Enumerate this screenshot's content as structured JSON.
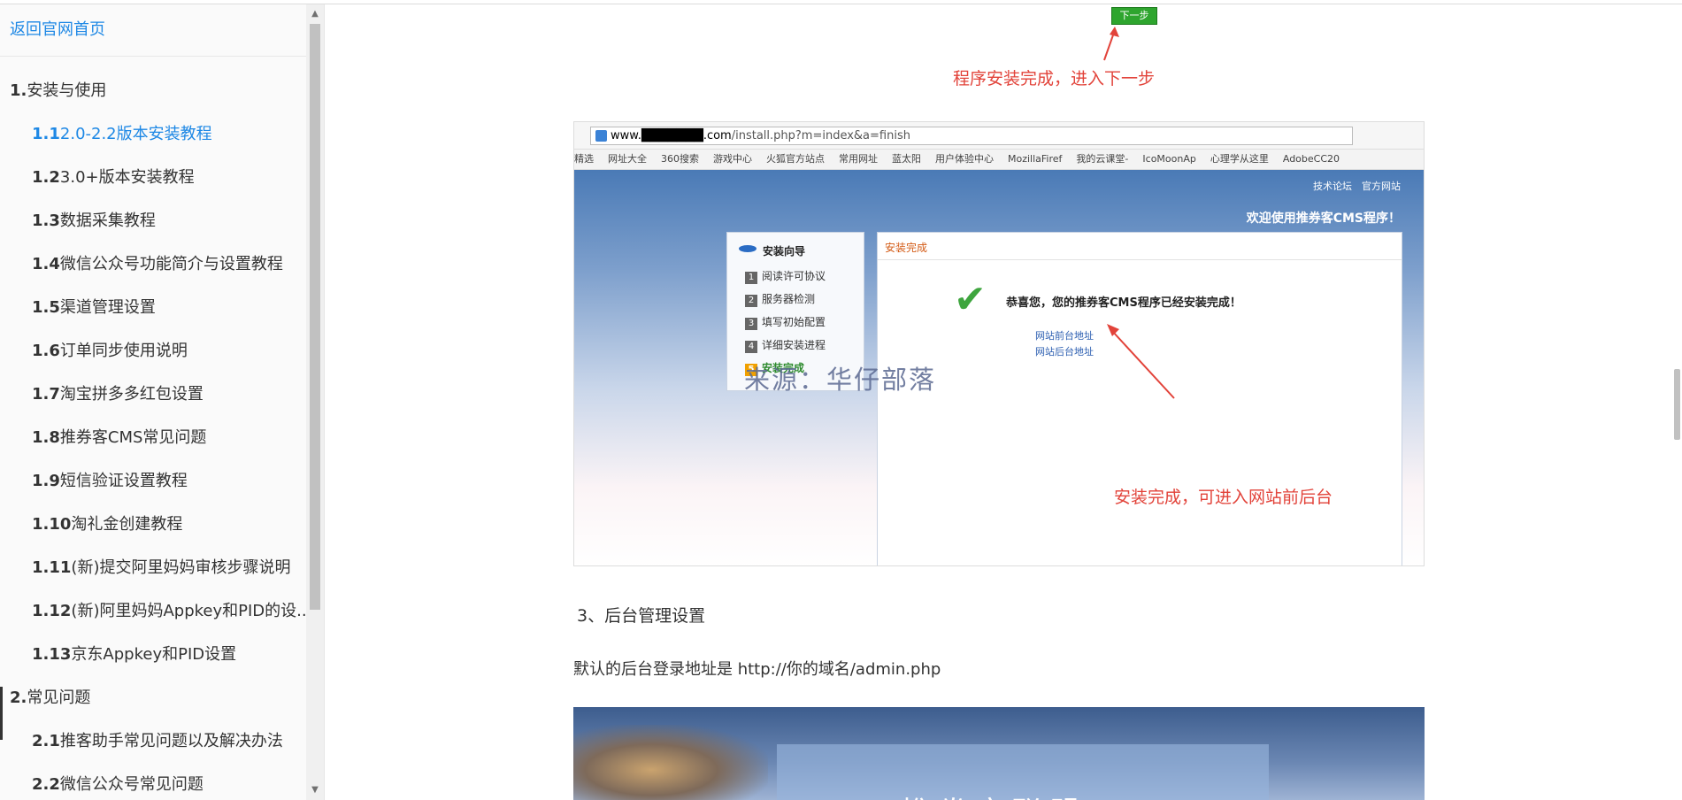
{
  "sidebar": {
    "home_link": "返回官网首页",
    "items": [
      {
        "num": "1.",
        "label": "安装与使用",
        "level": 1,
        "active": false
      },
      {
        "num": "1.1",
        "label": "2.0-2.2版本安装教程",
        "level": 2,
        "active": true
      },
      {
        "num": "1.2",
        "label": "3.0+版本安装教程",
        "level": 2,
        "active": false
      },
      {
        "num": "1.3",
        "label": "数据采集教程",
        "level": 2,
        "active": false
      },
      {
        "num": "1.4",
        "label": "微信公众号功能简介与设置教程",
        "level": 2,
        "active": false
      },
      {
        "num": "1.5",
        "label": "渠道管理设置",
        "level": 2,
        "active": false
      },
      {
        "num": "1.6",
        "label": "订单同步使用说明",
        "level": 2,
        "active": false
      },
      {
        "num": "1.7",
        "label": "淘宝拼多多红包设置",
        "level": 2,
        "active": false
      },
      {
        "num": "1.8",
        "label": "推券客CMS常见问题",
        "level": 2,
        "active": false
      },
      {
        "num": "1.9",
        "label": "短信验证设置教程",
        "level": 2,
        "active": false
      },
      {
        "num": "1.10",
        "label": "淘礼金创建教程",
        "level": 2,
        "active": false
      },
      {
        "num": "1.11",
        "label": "(新)提交阿里妈妈审核步骤说明",
        "level": 2,
        "active": false
      },
      {
        "num": "1.12",
        "label": "(新)阿里妈妈Appkey和PID的设...",
        "level": 2,
        "active": false
      },
      {
        "num": "1.13",
        "label": "京东Appkey和PID设置",
        "level": 2,
        "active": false
      },
      {
        "num": "2.",
        "label": "常见问题",
        "level": 1,
        "active": false
      },
      {
        "num": "2.1",
        "label": "推客助手常见问题以及解决办法",
        "level": 2,
        "active": false
      },
      {
        "num": "2.2",
        "label": "微信公众号常见问题",
        "level": 2,
        "active": false
      }
    ]
  },
  "content": {
    "next_button": "下一步",
    "annotation_top": "程序安装完成，进入下一步",
    "screenshot1": {
      "url_host": "www.███████.com",
      "url_path": "/install.php?m=index&a=finish",
      "bookmarks": [
        "精选",
        "网址大全",
        "360搜索",
        "游戏中心",
        "火狐官方站点",
        "常用网址",
        "蓝太阳",
        "用户体验中心",
        "MozillaFiref",
        "我的云课堂-",
        "IcoMoonAp",
        "心理学从这里",
        "AdobeCC20"
      ],
      "top_links": "技术论坛　官方网站",
      "welcome": "欢迎使用推券客CMS程序！",
      "wizard_title": "安装向导",
      "steps": [
        {
          "num": "1",
          "label": "阅读许可协议"
        },
        {
          "num": "2",
          "label": "服务器检测"
        },
        {
          "num": "3",
          "label": "填写初始配置"
        },
        {
          "num": "4",
          "label": "详细安装进程"
        },
        {
          "num": "5",
          "label": "安装完成"
        }
      ],
      "panel_title": "安装完成",
      "congrats": "恭喜您，您的推券客CMS程序已经安装完成！",
      "link_front": "网站前台地址",
      "link_back": "网站后台地址",
      "watermark": "来源：华仔部落",
      "annotation": "安装完成，可进入网站前后台"
    },
    "section_title": "3、后台管理设置",
    "paragraph": "默认的后台登录地址是  http://你的域名/admin.php",
    "screenshot2_text": "推券客联盟"
  }
}
